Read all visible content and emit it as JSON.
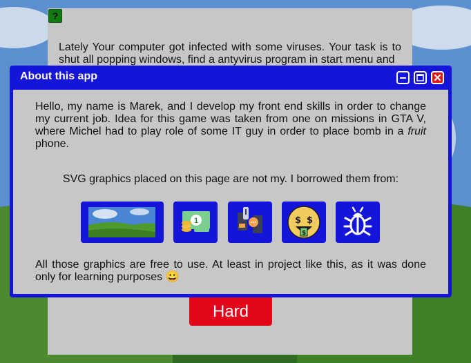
{
  "game": {
    "help_label": "?",
    "intro_text": "Lately Your computer got infected with some viruses. Your task is to shut all popping windows, find a antyvirus program in start menu and",
    "difficulty_button_label": "Hard"
  },
  "dialog": {
    "title": "About this app",
    "text_part1": "Hello, my name is Marek, and I develop my front end skills in order to change my current job. Idea for this game was taken from one on missions in GTA V, where Michel had to play role of some IT guy in order to place bomb in a ",
    "text_emphasis": "fruit",
    "text_part2": " phone.",
    "credit_text": "SVG graphics placed on this page are not my. I borrowed them from:",
    "graphics": [
      "wallpaper-image",
      "money-icon",
      "phone-app-icon",
      "money-face-emoji-icon",
      "bug-icon"
    ],
    "note_text": "All those graphics are free to use. At least in project like this, as it was done only for learning purposes ",
    "note_emoji": "😀"
  },
  "colors": {
    "dialog_blue": "#1515d9",
    "panel_gray": "#c7c7c7",
    "hard_red": "#e3061a",
    "close_red": "#e01818",
    "help_green": "#117a11"
  }
}
